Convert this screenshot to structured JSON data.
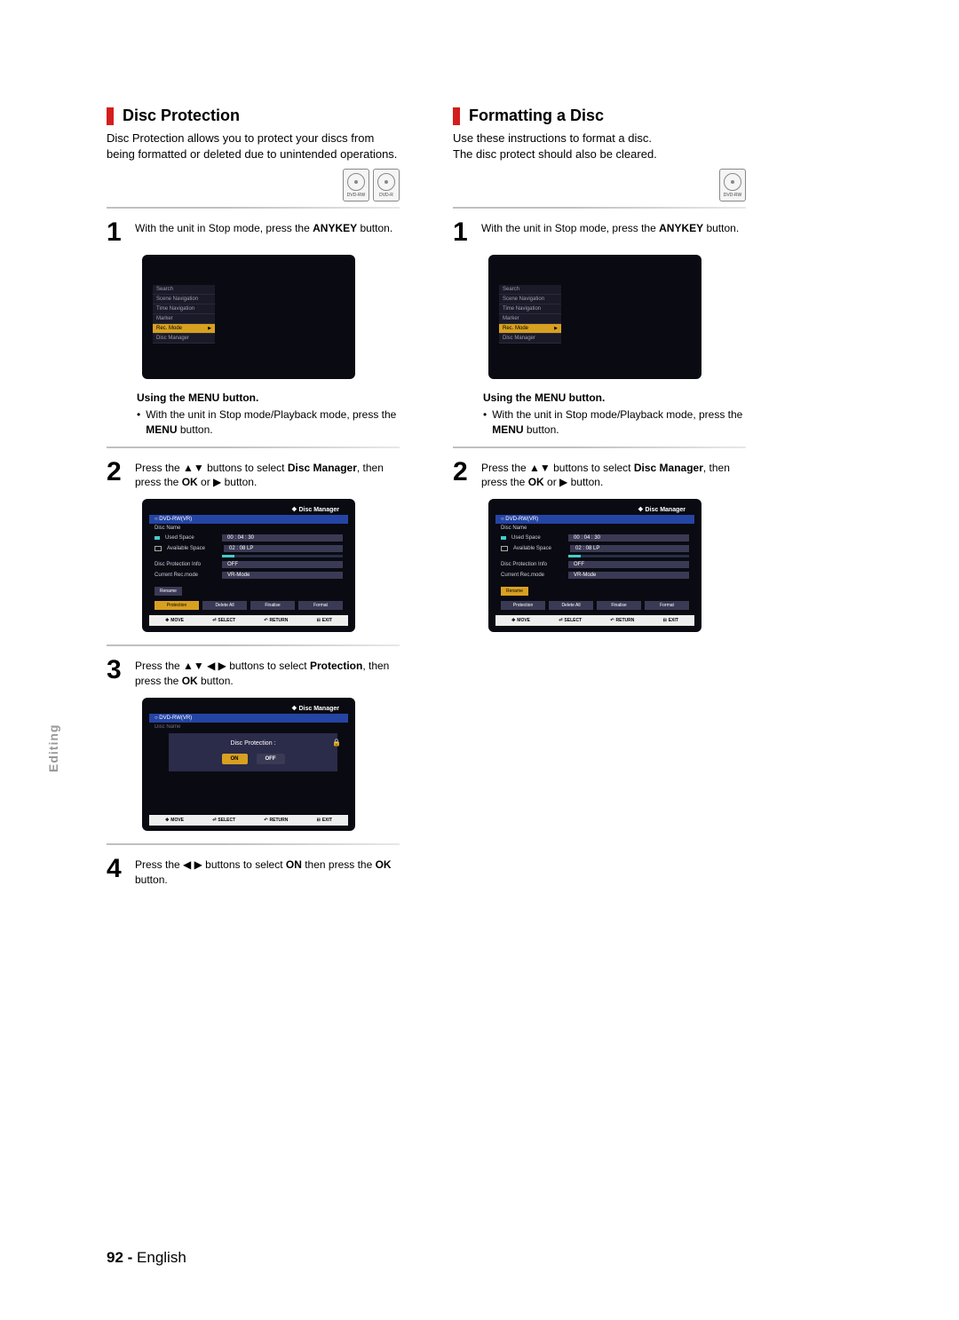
{
  "left": {
    "title": "Disc Protection",
    "intro": "Disc Protection allows you to protect your discs from being formatted or deleted due to unintended operations.",
    "discTypes": {
      "rw": "DVD-RW",
      "r": "DVD-R"
    },
    "step1a": "With the unit in Stop mode, press the ",
    "step1bold": "ANYKEY",
    "step1b": " button.",
    "menuHeading": "Using the MENU button.",
    "menuBulletA": "With the unit in Stop mode/Playback mode, press the ",
    "menuBulletBold": "MENU",
    "menuBulletB": " button.",
    "step2a": "Press the ▲▼ buttons to select ",
    "step2bold": "Disc Manager",
    "step2b": ", then press the ",
    "step2bold2": "OK",
    "step2c": " or ▶ button.",
    "step3a": "Press the ▲▼ ◀ ▶ buttons to select ",
    "step3bold": "Protection",
    "step3b": ", then press the ",
    "step3bold2": "OK",
    "step3c": " button.",
    "step4a": "Press the ◀ ▶ buttons to select ",
    "step4bold": "ON",
    "step4b": " then press the ",
    "step4bold2": "OK",
    "step4c": " button."
  },
  "right": {
    "title": "Formatting a Disc",
    "introA": "Use these instructions to format a disc.",
    "introB": "The disc protect should also be cleared.",
    "discType": "DVD-RW",
    "step1a": "With the unit in Stop mode, press the ",
    "step1bold": "ANYKEY",
    "step1b": " button.",
    "menuHeading": "Using the MENU button.",
    "menuBulletA": "With the unit in Stop mode/Playback mode, press the ",
    "menuBulletBold": "MENU",
    "menuBulletB": " button.",
    "step2a": "Press the ▲▼ buttons to select ",
    "step2bold": "Disc Manager",
    "step2b": ", then press the ",
    "step2bold2": "OK",
    "step2c": " or ▶ button."
  },
  "osdMenu": {
    "items": [
      "Search",
      "Scene Navigation",
      "Time Navigation",
      "Marker",
      "Rec. Mode",
      "Disc Manager"
    ]
  },
  "dm": {
    "title": "Disc Manager",
    "header": "DVD-RW(VR)",
    "discName": "Disc Name",
    "usedSpace": "Used Space",
    "usedVal": "00 : 04 : 30",
    "availSpace": "Available Space",
    "availVal": "02 : 08 LP",
    "protInfo": "Disc Protection Info",
    "protVal": "OFF",
    "recMode": "Current Rec.mode",
    "recVal": "VR-Mode",
    "rename": "Rename",
    "btns": [
      "Protection",
      "Delete All",
      "Finalise",
      "Format"
    ],
    "nav": {
      "move": "MOVE",
      "select": "SELECT",
      "return": "RETURN",
      "exit": "EXIT"
    }
  },
  "dialog": {
    "title": "Disc Protection :",
    "on": "ON",
    "off": "OFF"
  },
  "sideTab": "Editing",
  "footer": {
    "page": "92 -",
    "lang": "English"
  }
}
